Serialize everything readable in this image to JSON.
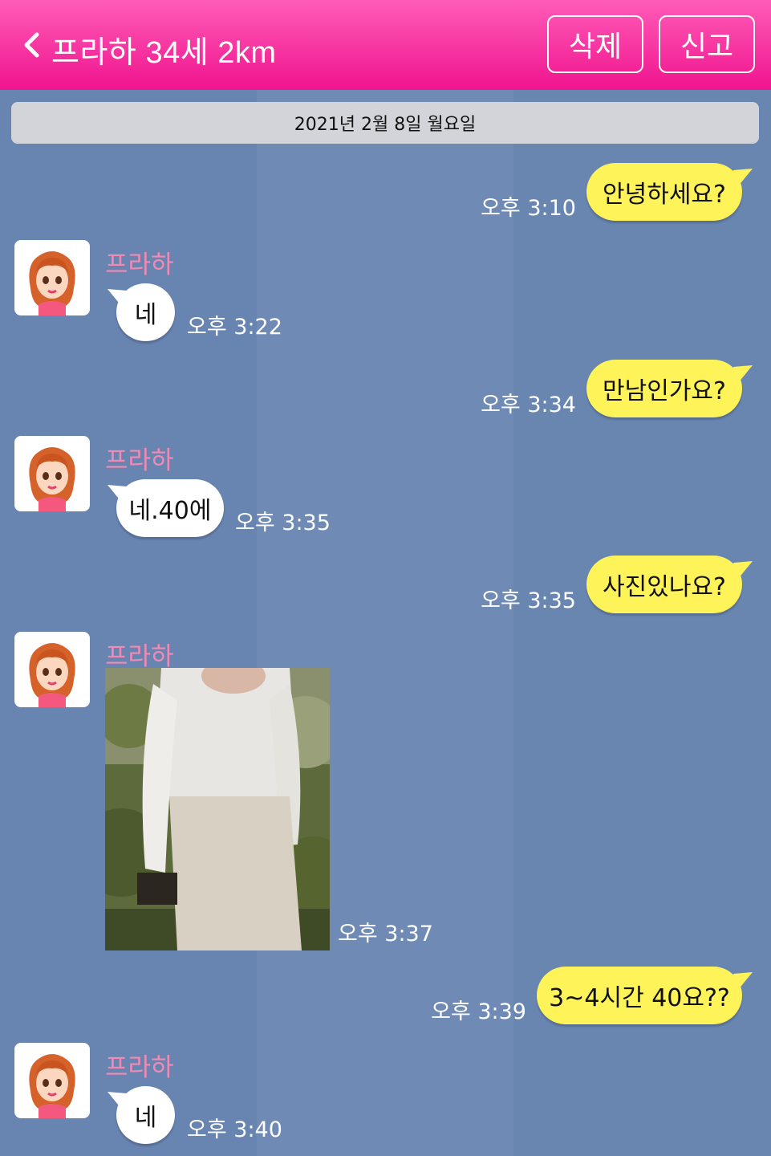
{
  "header": {
    "title": "프라하 34세 2km",
    "delete_label": "삭제",
    "report_label": "신고",
    "color": "#f0148e"
  },
  "date_label": "2021년 2월 8일 월요일",
  "messages": [
    {
      "from": "me",
      "text": "안녕하세요?",
      "time": "오후 3:10"
    },
    {
      "from": "partner",
      "sender": "프라하",
      "text": "네",
      "time": "오후 3:22"
    },
    {
      "from": "me",
      "text": "만남인가요?",
      "time": "오후 3:34"
    },
    {
      "from": "partner",
      "sender": "프라하",
      "text": "네.40에",
      "time": "오후 3:35"
    },
    {
      "from": "me",
      "text": "사진있나요?",
      "time": "오후 3:35"
    },
    {
      "from": "partner",
      "sender": "프라하",
      "type": "photo",
      "time": "오후 3:37"
    },
    {
      "from": "me",
      "text": "3~4시간 40요??",
      "time": "오후 3:39"
    },
    {
      "from": "partner",
      "sender": "프라하",
      "text": "네",
      "time": "오후 3:40"
    }
  ],
  "colors": {
    "background": "#6a86b0",
    "my_bubble": "#fff35a",
    "partner_bubble": "#ffffff",
    "sender_name": "#f28ab4"
  },
  "icons": [
    "chevron-left-icon",
    "avatar-icon"
  ]
}
